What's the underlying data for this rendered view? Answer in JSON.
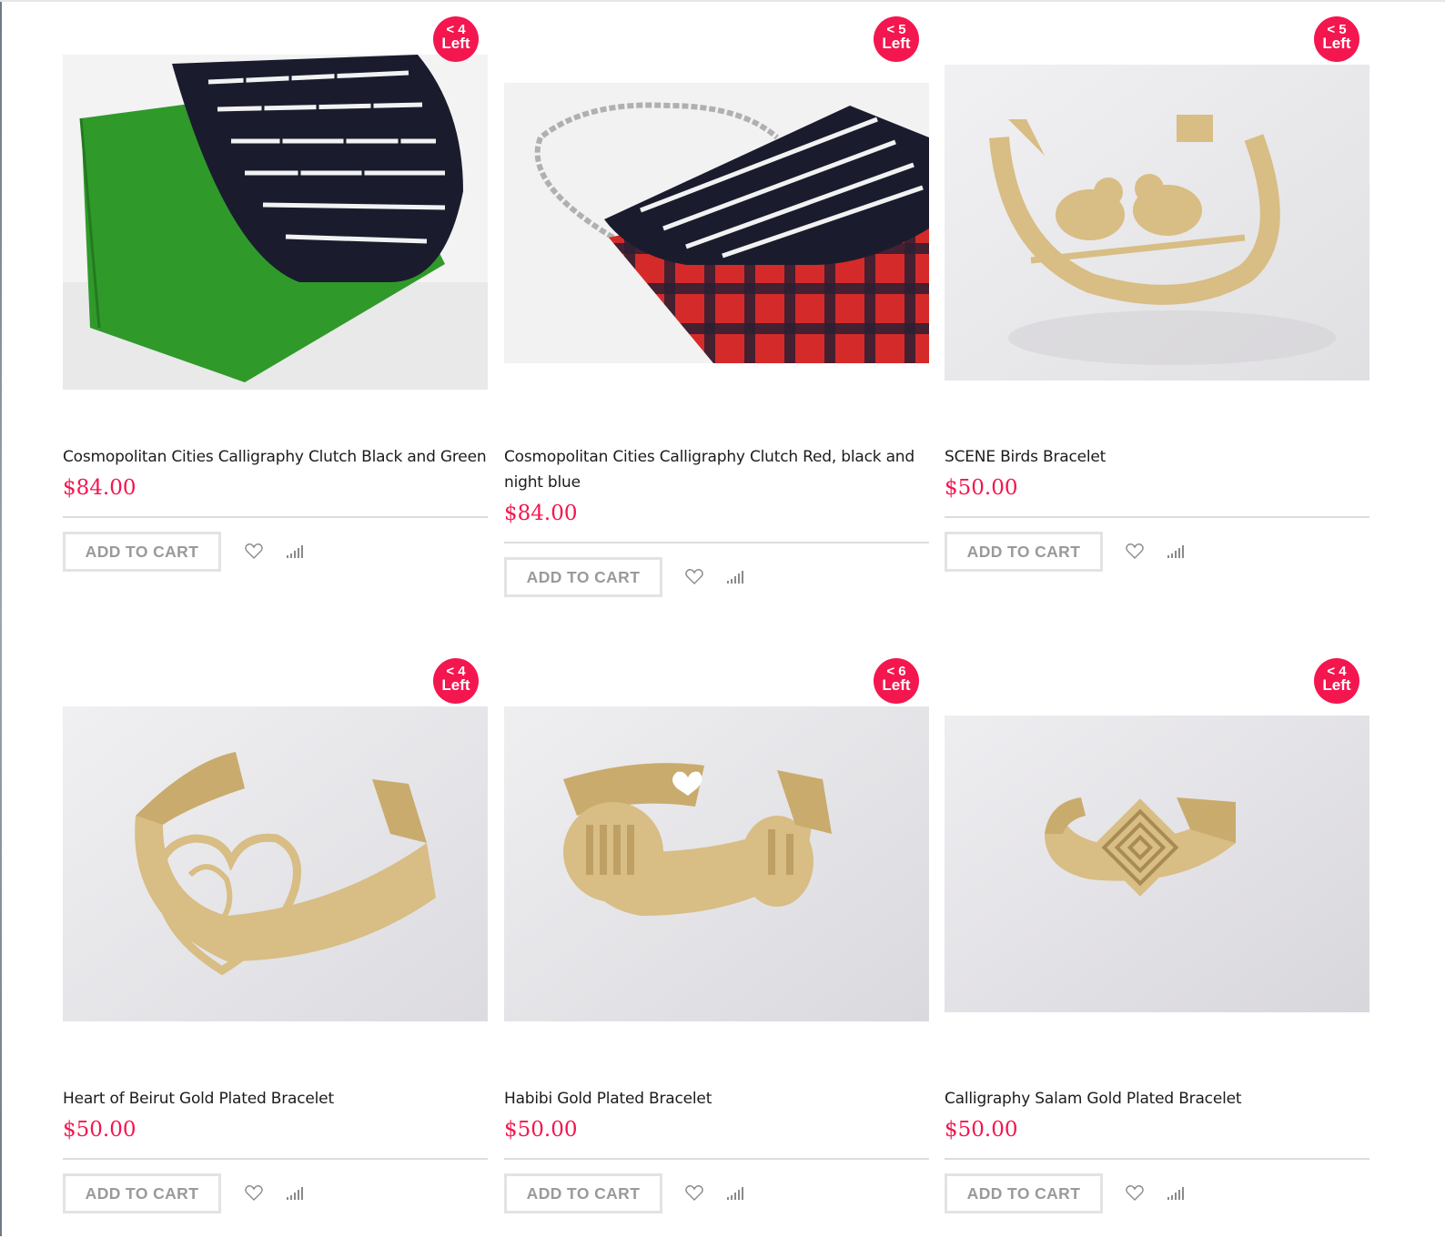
{
  "products": [
    {
      "badge_line1": "< 4",
      "badge_line2": "Left",
      "title": "Cosmopolitan Cities Calligraphy Clutch Black and Green",
      "price": "$84.00",
      "cart_label": "ADD TO CART",
      "image": "green-black-calligraphy-clutch",
      "wishlist_icon": "heart-icon",
      "compare_icon": "compare-bars-icon"
    },
    {
      "badge_line1": "< 5",
      "badge_line2": "Left",
      "title": "Cosmopolitan Cities Calligraphy Clutch Red, black and night blue",
      "price": "$84.00",
      "cart_label": "ADD TO CART",
      "image": "red-plaid-calligraphy-clutch-with-chain",
      "wishlist_icon": "heart-icon",
      "compare_icon": "compare-bars-icon"
    },
    {
      "badge_line1": "< 5",
      "badge_line2": "Left",
      "title": "SCENE Birds Bracelet",
      "price": "$50.00",
      "cart_label": "ADD TO CART",
      "image": "gold-birds-cuff-bracelet",
      "wishlist_icon": "heart-icon",
      "compare_icon": "compare-bars-icon"
    },
    {
      "badge_line1": "< 4",
      "badge_line2": "Left",
      "title": "Heart of Beirut Gold Plated Bracelet",
      "price": "$50.00",
      "cart_label": "ADD TO CART",
      "image": "gold-heart-cuff-bracelet",
      "wishlist_icon": "heart-icon",
      "compare_icon": "compare-bars-icon"
    },
    {
      "badge_line1": "< 6",
      "badge_line2": "Left",
      "title": "Habibi Gold Plated Bracelet",
      "price": "$50.00",
      "cart_label": "ADD TO CART",
      "image": "gold-habibi-cuff-bracelet",
      "wishlist_icon": "heart-icon",
      "compare_icon": "compare-bars-icon"
    },
    {
      "badge_line1": "< 4",
      "badge_line2": "Left",
      "title": "Calligraphy Salam Gold Plated Bracelet",
      "price": "$50.00",
      "cart_label": "ADD TO CART",
      "image": "gold-salam-square-cuff-bracelet",
      "wishlist_icon": "heart-icon",
      "compare_icon": "compare-bars-icon"
    }
  ],
  "colors": {
    "accent": "#f4164f",
    "title_text": "#1c1c1c",
    "button_text": "#9a9a9a",
    "button_border": "#e3e3e3",
    "divider": "#dcdcdc",
    "gold": "#d8bd84",
    "clutch_green": "#2f9a2a",
    "clutch_navy": "#1a1c2e",
    "plaid_red": "#d42a2a"
  }
}
